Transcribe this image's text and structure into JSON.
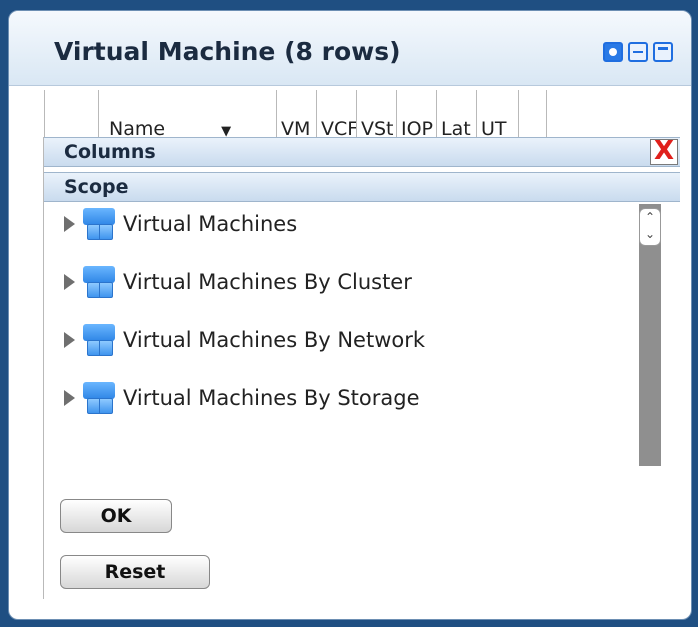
{
  "window": {
    "title": "Virtual Machine (8 rows)",
    "buttons": [
      "settings-icon",
      "minimize-icon",
      "maximize-icon"
    ]
  },
  "table": {
    "columns": [
      "Name",
      "VM",
      "VCF",
      "VSt",
      "IOP",
      "Lat",
      "UT"
    ]
  },
  "columns_panel": {
    "header": "Columns",
    "close_glyph": "X",
    "scope_label": "Scope",
    "tree_items": [
      {
        "label": "Virtual Machines"
      },
      {
        "label": "Virtual Machines By Cluster"
      },
      {
        "label": "Virtual Machines By Network"
      },
      {
        "label": "Virtual Machines By Storage"
      }
    ],
    "ok_label": "OK",
    "reset_label": "Reset"
  },
  "colors": {
    "accent": "#1f6ee0",
    "close": "#e0201c",
    "background": "#1f4f82"
  }
}
